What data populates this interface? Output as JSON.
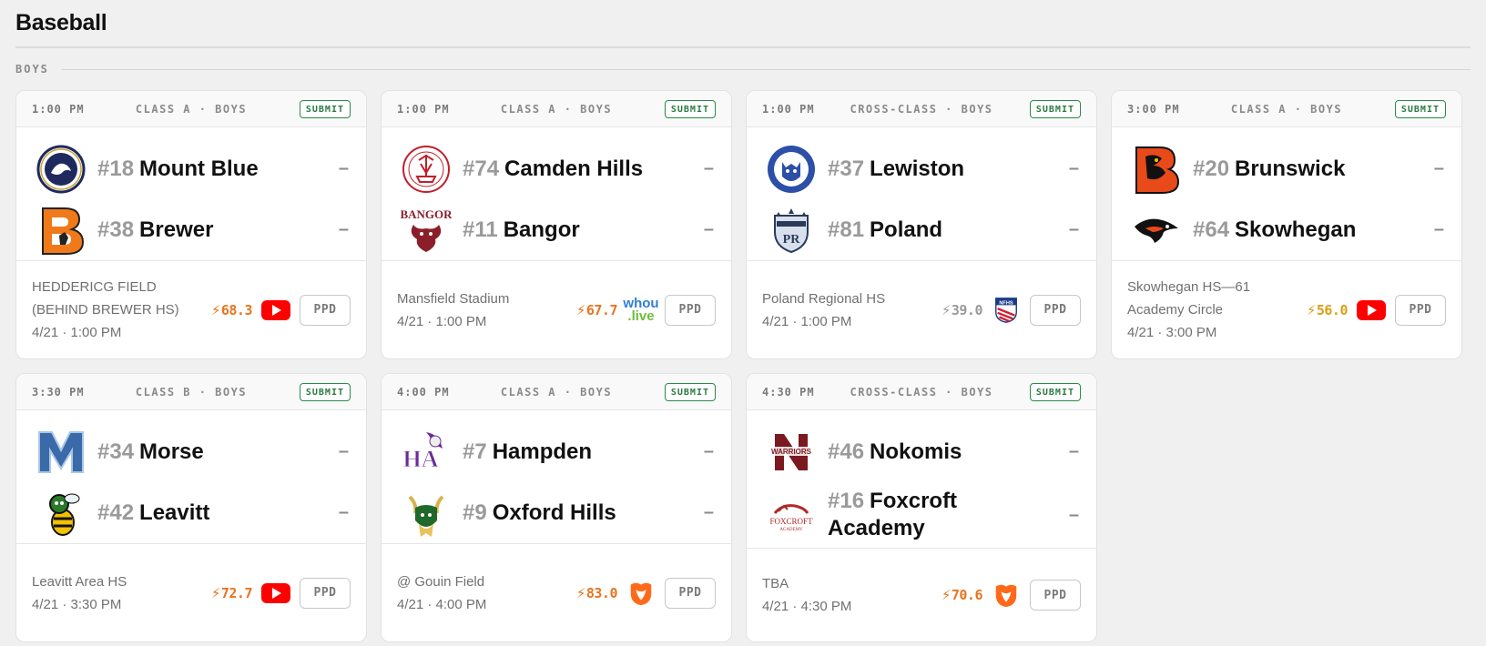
{
  "page": {
    "title": "Baseball",
    "section": "BOYS"
  },
  "colors": {
    "submit": "#2a7a40",
    "orange": "#e8741e",
    "gold": "#d9a015",
    "gray": "#9a9a9a",
    "youtube": "#ff0000"
  },
  "games": [
    {
      "time": "1:00 PM",
      "class": "CLASS A · BOYS",
      "submit": "SUBMIT",
      "teams": [
        {
          "rank": "#18",
          "name": "Mount Blue",
          "score": "–",
          "logo": "mount-blue-logo"
        },
        {
          "rank": "#38",
          "name": "Brewer",
          "score": "–",
          "logo": "brewer-logo"
        }
      ],
      "venue": [
        "HEDDERICG FIELD",
        "(BEHIND BREWER HS)"
      ],
      "datetime": "4/21 · 1:00 PM",
      "rating": "68.3",
      "rating_color": "#e8741e",
      "stream": "youtube-icon",
      "ppd": "PPD"
    },
    {
      "time": "1:00 PM",
      "class": "CLASS A · BOYS",
      "submit": "SUBMIT",
      "teams": [
        {
          "rank": "#74",
          "name": "Camden Hills",
          "score": "–",
          "logo": "camden-hills-logo"
        },
        {
          "rank": "#11",
          "name": "Bangor",
          "score": "–",
          "logo": "bangor-logo"
        }
      ],
      "venue": [
        "Mansfield Stadium"
      ],
      "datetime": "4/21 · 1:00 PM",
      "rating": "67.7",
      "rating_color": "#e8741e",
      "stream": "whou-live-icon",
      "stream_text": [
        "whou",
        ".live"
      ],
      "ppd": "PPD"
    },
    {
      "time": "1:00 PM",
      "class": "CROSS-CLASS · BOYS",
      "submit": "SUBMIT",
      "teams": [
        {
          "rank": "#37",
          "name": "Lewiston",
          "score": "–",
          "logo": "lewiston-logo"
        },
        {
          "rank": "#81",
          "name": "Poland",
          "score": "–",
          "logo": "poland-logo"
        }
      ],
      "venue": [
        "Poland Regional HS"
      ],
      "datetime": "4/21 · 1:00 PM",
      "rating": "39.0",
      "rating_color": "#9a9a9a",
      "stream": "nfhs-icon",
      "ppd": "PPD"
    },
    {
      "time": "3:00 PM",
      "class": "CLASS A · BOYS",
      "submit": "SUBMIT",
      "teams": [
        {
          "rank": "#20",
          "name": "Brunswick",
          "score": "–",
          "logo": "brunswick-logo"
        },
        {
          "rank": "#64",
          "name": "Skowhegan",
          "score": "–",
          "logo": "skowhegan-logo"
        }
      ],
      "venue": [
        "Skowhegan HS—61",
        "Academy Circle"
      ],
      "datetime": "4/21 · 3:00 PM",
      "rating": "56.0",
      "rating_color": "#d9a015",
      "stream": "youtube-icon",
      "ppd": "PPD"
    },
    {
      "time": "3:30 PM",
      "class": "CLASS B · BOYS",
      "submit": "SUBMIT",
      "teams": [
        {
          "rank": "#34",
          "name": "Morse",
          "score": "–",
          "logo": "morse-logo"
        },
        {
          "rank": "#42",
          "name": "Leavitt",
          "score": "–",
          "logo": "leavitt-logo"
        }
      ],
      "venue": [
        "Leavitt Area HS"
      ],
      "datetime": "4/21 · 3:30 PM",
      "rating": "72.7",
      "rating_color": "#e8741e",
      "stream": "youtube-icon",
      "ppd": "PPD"
    },
    {
      "time": "4:00 PM",
      "class": "CLASS A · BOYS",
      "submit": "SUBMIT",
      "teams": [
        {
          "rank": "#7",
          "name": "Hampden",
          "score": "–",
          "logo": "hampden-logo"
        },
        {
          "rank": "#9",
          "name": "Oxford Hills",
          "score": "–",
          "logo": "oxford-hills-logo"
        }
      ],
      "venue": [
        "@ Gouin Field"
      ],
      "datetime": "4/21 · 4:00 PM",
      "rating": "83.0",
      "rating_color": "#e8741e",
      "stream": "hudl-icon",
      "ppd": "PPD"
    },
    {
      "time": "4:30 PM",
      "class": "CROSS-CLASS · BOYS",
      "submit": "SUBMIT",
      "teams": [
        {
          "rank": "#46",
          "name": "Nokomis",
          "score": "–",
          "logo": "nokomis-logo"
        },
        {
          "rank": "#16",
          "name": "Foxcroft Academy",
          "score": "–",
          "logo": "foxcroft-logo",
          "name_lines": [
            "Foxcroft",
            "Academy"
          ]
        }
      ],
      "venue": [
        "TBA"
      ],
      "datetime": "4/21 · 4:30 PM",
      "rating": "70.6",
      "rating_color": "#e8741e",
      "stream": "hudl-icon",
      "ppd": "PPD"
    }
  ]
}
